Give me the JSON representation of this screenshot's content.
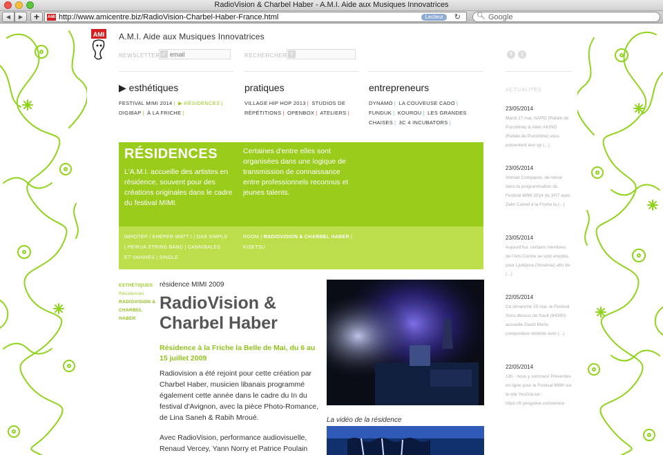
{
  "browser": {
    "window_title": "RadioVision & Charbel Haber - A.M.I. Aide aux Musiques Innovatrices",
    "url": "http://www.amicentre.biz/RadioVision-Charbel-Haber-France.html",
    "reader_label": "Lecteur",
    "search_placeholder": "Google",
    "favicon_text": "AMI"
  },
  "site": {
    "title": "A.M.I. Aide aux Musiques Innovatrices",
    "logo_text": "AMI",
    "newsletter_label": "NEWSLETTER",
    "email_placeholder": "email",
    "search_label": "RECHERCHER"
  },
  "categories": [
    {
      "title": "esthétiques",
      "marker": "▶",
      "links": [
        "FESTIVAL MIMI 2014",
        "RÉSIDENCES",
        "DIGIBAP",
        "À LA FRICHE"
      ]
    },
    {
      "title": "pratiques",
      "links": [
        "VILLAGE HIP HOP 2013",
        "STUDIOS DE RÉPÉTITIONS",
        "OPENBOX",
        "ATELIERS"
      ]
    },
    {
      "title": "entrepreneurs",
      "links": [
        "DYNAMO",
        "LA COUVEUSE CADO",
        "FUNDUK",
        "KOUROU",
        "LES GRANDES CHAISES",
        "3C 4 INCUBATORS"
      ]
    }
  ],
  "sidebar": {
    "heading": "ACTUALITÉS",
    "news": [
      {
        "date": "23/05/2014",
        "text": "Mardi 27 mai, NAPO (Rafale de Punchline) & Allen AKINO (Rafale de Punchline) vous présentent leur ep (...)"
      },
      {
        "date": "23/05/2014",
        "text": "Ahmad Compaoré, de retour dans la programmation du Festival MIMI 2014 (le 3/07 avec Zekri Camel à la Friche la (...)"
      },
      {
        "date": "23/05/2014",
        "text": "Aujourd'hui, certains membres de l'Ami Centre se sont envolés pour Ljubljana (Slovénie) afin de (...)"
      },
      {
        "date": "22/05/2014",
        "text": "Ce dimanche 25 mai, le Festival Sons dessus de Sault (84390) accueille David Merlo, compositeur émérite suivi (...)"
      },
      {
        "date": "22/05/2014",
        "text": "13h : nous y sommes! Préventes en ligne pour le Festival MIMI sur le site YesGoLive : https://fr.yesgolive.com/amice"
      }
    ]
  },
  "residences": {
    "title": "RÉSIDENCES",
    "intro": "L'A.M.I. accueille des artistes en résidence, souvent pour des créations originales dans le cadre du festival MIMI.",
    "intro2": "Certaines d'entre elles sont organisées dans une logique de transmission de connaissance entre professionnels reconnus et jeunes talents.",
    "list1": "IMHOTEP / KHEPER WATT I | DAS SIMPLE | PEIRUA STRING BAND | CANNIBALES ET VAHINÉS | SINGLE",
    "list2_a": "ROOM | ",
    "list2_b": "RADIOVISION & CHARBEL HABER",
    "list2_c": " | KISETSU"
  },
  "article": {
    "crumb1": "ESTHÉTIQUES",
    "crumb2": "Résidences",
    "crumb3": "RADIOVISION & CHARBEL HABER",
    "kicker": "résidence MIMI 2009",
    "title": "RadioVision & Charbel Haber",
    "subtitle": "Résidence à la Friche la Belle de Mai, du 6 au 15 juillet 2009",
    "body": "Radiovision a été rejoint pour cette création par Charbel Haber, musicien libanais programmé également cette année dans le cadre du In du festival d'Avignon, avec la pièce Photo-Romance, de Lina Saneh & Rabih Mroué.",
    "body2": "Avec RadioVision, performance audiovisuelle, Renaud Vercey, Yann Norry et Patrice Poulain",
    "video_label": "La vidéo de la résidence"
  },
  "colors": {
    "accent_green": "#9acc1c",
    "light_green": "#bcde4b",
    "pattern_green": "#8fd31a"
  }
}
